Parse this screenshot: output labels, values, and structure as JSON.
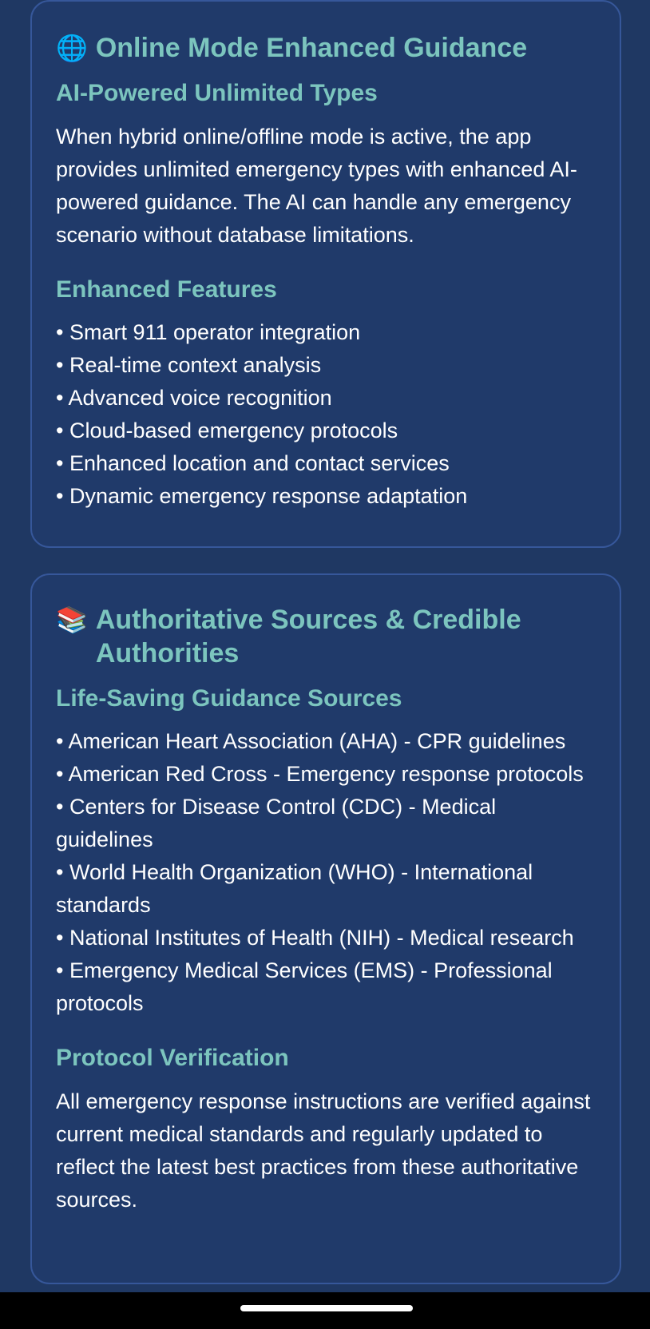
{
  "online_card": {
    "icon": "globe-icon",
    "icon_glyph": "🌐",
    "title": "Online Mode Enhanced Guidance",
    "section1_title": "AI-Powered Unlimited Types",
    "section1_text": "When hybrid online/offline mode is active, the app provides unlimited emergency types with enhanced AI-powered guidance. The AI can handle any emergency scenario without database limitations.",
    "section2_title": "Enhanced Features",
    "features": [
      "• Smart 911 operator integration",
      "• Real-time context analysis",
      "• Advanced voice recognition",
      "• Cloud-based emergency protocols",
      "• Enhanced location and contact services",
      "• Dynamic emergency response adaptation"
    ]
  },
  "sources_card": {
    "icon": "books-icon",
    "icon_glyph": "📚",
    "title": "Authoritative Sources & Credible Authorities",
    "section1_title": "Life-Saving Guidance Sources",
    "sources": [
      "• American Heart Association (AHA) - CPR guidelines",
      "• American Red Cross - Emergency response protocols",
      "• Centers for Disease Control (CDC) - Medical guidelines",
      "• World Health Organization (WHO) - International standards",
      "• National Institutes of Health (NIH) - Medical research",
      "• Emergency Medical Services (EMS) - Professional protocols"
    ],
    "section2_title": "Protocol Verification",
    "section2_text": "All emergency response instructions are verified against current medical standards and regularly updated to reflect the latest best practices from these authoritative sources."
  },
  "colors": {
    "background": "#1f3863",
    "card": "#203a6a",
    "card_border": "#36579a",
    "accent": "#7cc5be",
    "text": "#ffffff"
  }
}
